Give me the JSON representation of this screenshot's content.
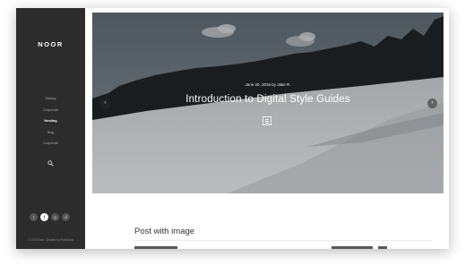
{
  "brand": {
    "logo": "NOOR"
  },
  "sidebar": {
    "items": [
      {
        "label": "Startup",
        "active": false
      },
      {
        "label": "Corporate",
        "active": false
      },
      {
        "label": "Hosting",
        "active": true
      },
      {
        "label": "Blog",
        "active": false
      },
      {
        "label": "Corporate",
        "active": false
      }
    ],
    "search_icon": "search-icon",
    "socials": [
      {
        "name": "twitter-icon",
        "glyph": "t"
      },
      {
        "name": "facebook-icon",
        "glyph": "f"
      },
      {
        "name": "googleplus-icon",
        "glyph": "g"
      },
      {
        "name": "dribbble-icon",
        "glyph": "d"
      }
    ],
    "copyright": "© 2015 Noor, Created by PixelDima"
  },
  "hero": {
    "meta": "June 20, 2015 by Jake R.",
    "title": "Introduction to Digital Style Guides",
    "prev_glyph": "‹",
    "next_glyph": "›"
  },
  "section": {
    "title": "Post with image"
  },
  "colors": {
    "sidebar_bg": "#2c2c2c",
    "text_dark": "#333333"
  }
}
